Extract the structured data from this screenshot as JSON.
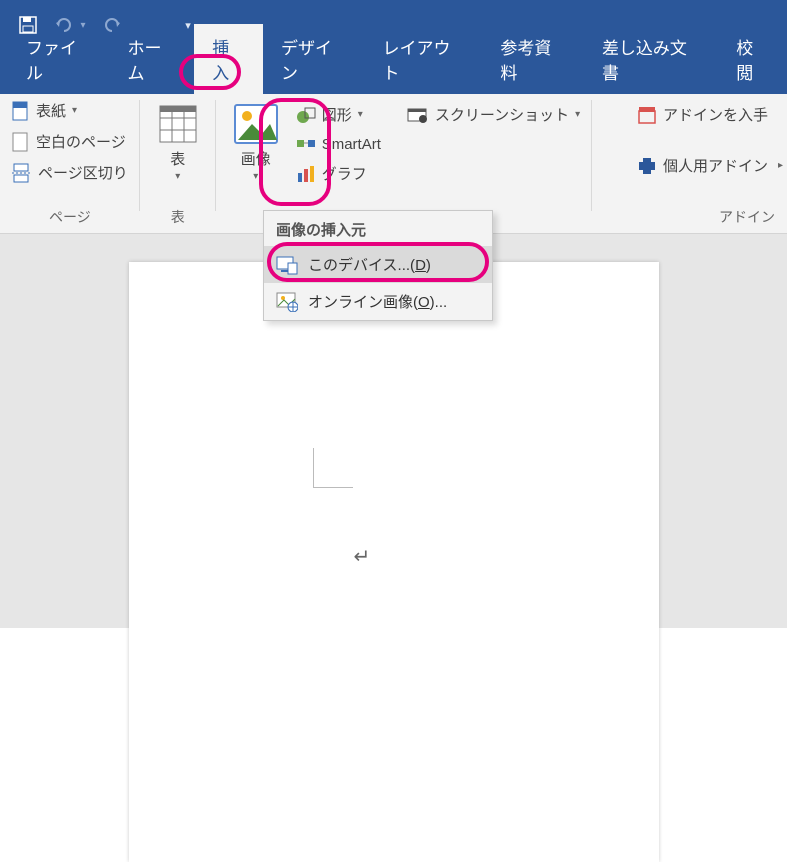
{
  "tabs": {
    "file": "ファイル",
    "home": "ホーム",
    "insert": "挿入",
    "design": "デザイン",
    "layout": "レイアウト",
    "references": "参考資料",
    "mailings": "差し込み文書",
    "review": "校閲"
  },
  "pages_group": {
    "cover": "表紙",
    "blank": "空白のページ",
    "break": "ページ区切り",
    "label": "ページ"
  },
  "tables_group": {
    "table": "表",
    "label": "表"
  },
  "illust_group": {
    "picture": "画像",
    "shapes": "図形",
    "smartart": "SmartArt",
    "chart": "グラフ",
    "screenshot": "スクリーンショット"
  },
  "addins_group": {
    "get": "アドインを入手",
    "my": "個人用アドイン",
    "label": "アドイン"
  },
  "dropdown": {
    "header": "画像の挿入元",
    "device": "このデバイス...(",
    "device_key": "D",
    "device_tail": ")",
    "online": "オンライン画像(",
    "online_key": "O",
    "online_tail": ")..."
  },
  "paragraph_mark": "↵"
}
